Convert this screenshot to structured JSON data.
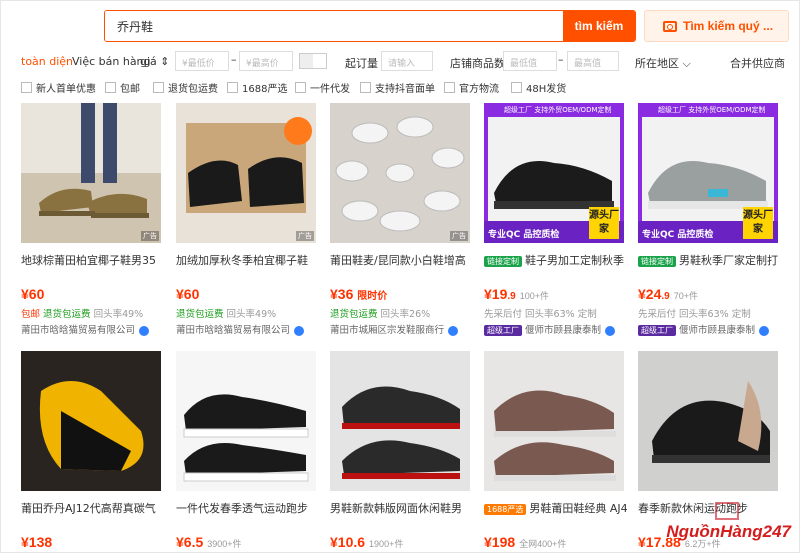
{
  "search": {
    "value": "乔丹鞋",
    "button": "tìm kiếm",
    "image_search": "Tìm kiếm quý ..."
  },
  "filters": {
    "sort_overall": "toàn diện",
    "sort_service": "Việc bán hàng",
    "sort_price": "giá ⇕",
    "price_min_ph": "¥最低价",
    "price_max_ph": "¥最高价",
    "dash": "–",
    "moq_label": "起订量",
    "moq_ph": "请输入",
    "store_qty_label": "店铺商品数",
    "store_min_ph": "最低值",
    "store_max_ph": "最高值",
    "region": "所在地区 ⌵",
    "merge_supplier": "合并供应商"
  },
  "checks": [
    "新人首单优惠",
    "包邮",
    "退货包运费",
    "1688严选",
    "一件代发",
    "支持抖音面单",
    "官方物流",
    "48H发货"
  ],
  "products": [
    {
      "title": "地球棕莆田柏宜椰子鞋男35",
      "price": "60",
      "price_suffix": "",
      "sold": "",
      "meta1": "包邮",
      "meta2": "退货包运费",
      "meta3": "回头率49%",
      "store": "莆田市晗晗猫贸易有限公司",
      "img": "tan"
    },
    {
      "title": "加绒加厚秋冬季柏宜椰子鞋",
      "price": "60",
      "price_suffix": "",
      "sold": "",
      "meta1": "",
      "meta2": "退货包运费",
      "meta3": "回头率49%",
      "store": "莆田市晗晗猫贸易有限公司",
      "img": "black-box"
    },
    {
      "title": "莆田鞋麦/昆同款小白鞋增高",
      "price": "36",
      "price_suffix": "限时价",
      "sold": "",
      "meta1": "",
      "meta2": "退货包运费",
      "meta3": "回头率26%",
      "store": "莆田市城厢区宗发鞋服商行",
      "img": "white-circle"
    },
    {
      "title": "鞋子男加工定制秋季",
      "price": "19",
      "price_suffix": ".9",
      "sold": "100+件",
      "meta1": "先采后付",
      "meta2": "回头率63%",
      "meta3": "定制",
      "store": "偃师市顾县康泰制",
      "img": "black-sport",
      "label_tag": "链接定制",
      "ribbon": "超级工厂 支持外贸OEM/ODM定制"
    },
    {
      "title": "男鞋秋季厂家定制打",
      "price": "24",
      "price_suffix": ".9",
      "sold": "70+件",
      "meta1": "先采后付",
      "meta2": "回头率63%",
      "meta3": "定制",
      "store": "偃师市顾县康泰制",
      "img": "grey-sport",
      "label_tag": "链接定制",
      "ribbon": "超级工厂 支持外贸OEM/ODM定制"
    },
    {
      "title": "莆田乔丹AJ12代高帮真碳气",
      "price": "138",
      "price_suffix": "",
      "sold": "",
      "img": "yellow-black"
    },
    {
      "title": "一件代发春季透气运动跑步",
      "price": "6.5",
      "price_suffix": "",
      "sold": "3900+件",
      "img": "black-white"
    },
    {
      "title": "男鞋新款韩版网面休闲鞋男",
      "price": "10.6",
      "price_suffix": "",
      "sold": "1900+件",
      "img": "black-red"
    },
    {
      "title": "男鞋莆田鞋经典 AJ4",
      "price": "198",
      "price_suffix": "",
      "sold": "全网400+件",
      "img": "brown",
      "label_tag": "1688严选"
    },
    {
      "title": "春季新款休闲运动跑步",
      "price": "17.88",
      "price_suffix": "",
      "sold": "6.2万+件",
      "img": "black-hand"
    }
  ],
  "ribbon_title": "专业QC 品控质检",
  "yellow_tag": "源头厂家",
  "watermark": "NguồnHàng247",
  "colors": {
    "accent": "#ff5000",
    "price": "#ff3300",
    "green": "#1a9b1a",
    "purple": "#8a2be2"
  }
}
